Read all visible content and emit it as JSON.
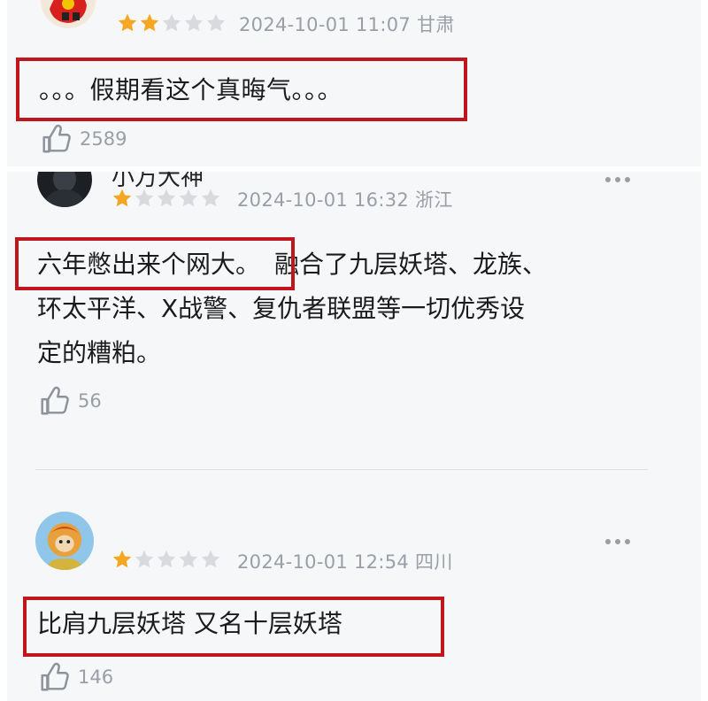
{
  "comments": [
    {
      "username": "",
      "rating": 2,
      "date": "2024-10-01 11:07",
      "location": "甘肃",
      "text": "。。。假期看这个真晦气。。。",
      "likes": "2589",
      "highlight_text": "。。。假期看这个真晦气。。。"
    },
    {
      "username": "小万大神",
      "rating": 1,
      "date": "2024-10-01 16:32",
      "location": "浙江",
      "highlight_text": "六年憋出来个网大。",
      "text_rest_line1": "融合了九层妖塔、龙族、",
      "text_line2": "环太平洋、X战警、复仇者联盟等一切优秀设",
      "text_line3": "定的糟粕。",
      "likes": "56"
    },
    {
      "username": "",
      "rating": 1,
      "date": "2024-10-01 12:54",
      "location": "四川",
      "text": "比肩九层妖塔 又名十层妖塔",
      "likes": "146"
    }
  ],
  "colors": {
    "star_on": "#f5a623",
    "star_off": "#d8dade",
    "highlight_border": "#c0161d",
    "meta_text": "#9a9ea6",
    "panel_bg": "#f6f7f9"
  },
  "icons": {
    "star": "star-icon",
    "like": "thumbs-up-icon",
    "more": "more-dots-icon"
  }
}
